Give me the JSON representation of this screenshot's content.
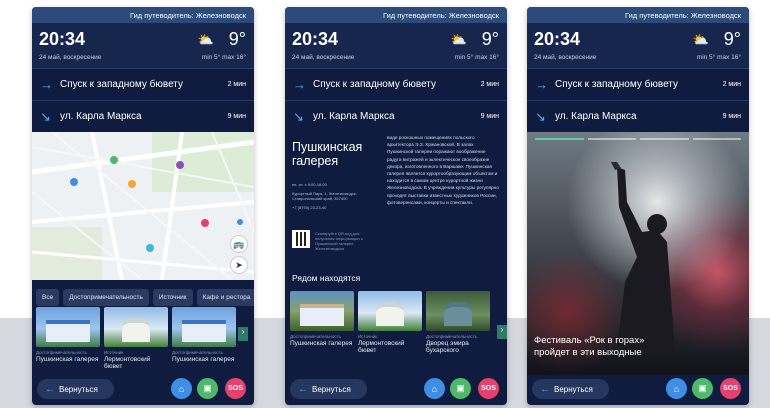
{
  "header_title": "Гид путеводитель: Железноводск",
  "weather": {
    "time": "20:34",
    "date": "24 май, воскресение",
    "temp": "9°",
    "range": "min 5° max 16°"
  },
  "routes": [
    {
      "name": "Спуск к западному бювету",
      "duration": "2 мин",
      "arrow": "→"
    },
    {
      "name": "ул. Карла Маркса",
      "duration": "9 мин",
      "arrow": "↘"
    }
  ],
  "filters": [
    "Все",
    "Достопримечательность",
    "Источник",
    "Кафе и рестора"
  ],
  "map_cards": [
    {
      "category": "Достопримечательность",
      "title": "Пушкинская галерея"
    },
    {
      "category": "Источник",
      "title": "Лермонтовский бювет"
    },
    {
      "category": "Достопримечательность",
      "title": "Пушкинская галерея"
    },
    {
      "category": "Парк",
      "title": "Парк"
    }
  ],
  "gallery": {
    "title_line1": "Пушкинская",
    "title_line2": "галерея",
    "hours": "пн.-пт. с 9:00-18:00",
    "address": "Курортный Парк, 1, Железноводск, Ставропольский край, 357400",
    "phone": "+7 (8793) 23-23-40",
    "qr_text": "Сканируйте QR-код для получения информации о Пушкинской галерее Железноводска",
    "description": "виде роскошных помещениях польского архитектора Э.З. Хржановской. В залах Пушкинской галереи поражают воображение радуга витражей и эклектическое своеобразие декора, изготовленного в Варшаве. Пушкинская галерея является курортообразующим объектом и находится в самом центре курортной жизни Железноводска. В учреждении культуры регулярно проходят выставки известных художников России, фотовернисажи, концерты и спектакли.",
    "nearby_title": "Рядом находятся",
    "nearby": [
      {
        "category": "Достопримечательность",
        "title": "Пушкинская галерея"
      },
      {
        "category": "Источник",
        "title": "Лермонтовский бювет"
      },
      {
        "category": "Достопримечательность",
        "title": "Дворец эмира бухарского"
      },
      {
        "category": "Парк",
        "title": "Каск"
      }
    ]
  },
  "event": {
    "title_line1": "Фестиваль «Рок в горах»",
    "title_line2": "пройдет в эти выходные"
  },
  "bottom": {
    "back_label": "Вернуться",
    "sos_label": "SOS"
  },
  "colors": {
    "background": "#0f1c3f",
    "accent": "#4ab0ff",
    "home": "#3f8ee3",
    "map": "#4fb86a",
    "sos": "#e4416e"
  }
}
